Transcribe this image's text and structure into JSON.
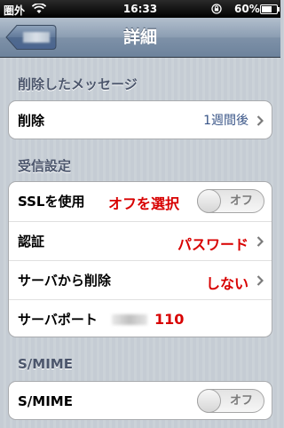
{
  "status_bar": {
    "carrier": "圏外",
    "time": "16:33",
    "battery": "60%",
    "wifi_icon": "wifi-icon",
    "lock_icon": "rotation-lock-icon"
  },
  "nav": {
    "title": "詳細",
    "back_icon": "back-arrow-icon"
  },
  "sections": {
    "deleted": {
      "header": "削除したメッセージ",
      "row_label": "削除",
      "row_value": "1週間後"
    },
    "incoming": {
      "header": "受信設定",
      "ssl_label": "SSLを使用",
      "ssl_annotation": "オフを選択",
      "ssl_toggle": "オフ",
      "auth_label": "認証",
      "auth_value": "パスワード",
      "delete_from_server_label": "サーバから削除",
      "delete_from_server_value": "しない",
      "port_label": "サーバポート",
      "port_value": "110"
    },
    "smime": {
      "header": "S/MIME",
      "row_label": "S/MIME",
      "toggle": "オフ"
    }
  },
  "colors": {
    "annotation": "#d80000",
    "value_blue": "#385487",
    "header_gray": "#4c566c"
  }
}
